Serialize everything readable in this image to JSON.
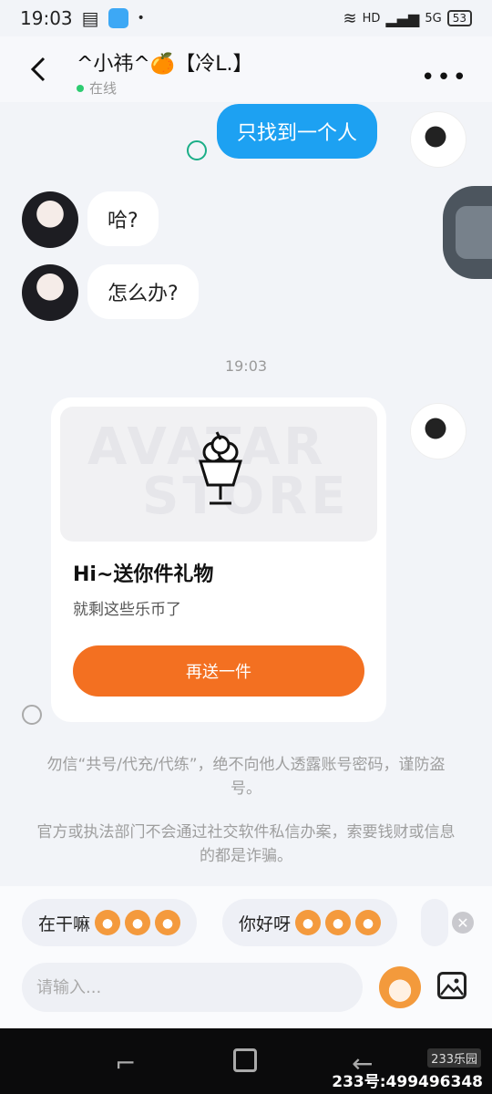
{
  "status_bar": {
    "time": "19:03",
    "battery": "53",
    "network": "5G"
  },
  "header": {
    "back_icon": "back-arrow-icon",
    "title": "^小祎^🍊【冷L.】",
    "status": "在线",
    "more_icon": "more-dots-icon"
  },
  "messages": [
    {
      "from": "me",
      "text": "只找到一个人"
    },
    {
      "from": "other",
      "text": "哈?"
    },
    {
      "from": "other",
      "text": "怎么办?"
    }
  ],
  "timestamp": "19:03",
  "gift": {
    "watermark_line1": "AVATAR",
    "watermark_line2": "STORE",
    "title": "Hi~送你件礼物",
    "subtitle": "就剩这些乐币了",
    "button": "再送一件"
  },
  "notices": [
    "勿信“共号/代充/代练”，绝不向他人透露账号密码，谨防盗号。",
    "官方或执法部门不会通过社交软件私信办案，索要钱财或信息的都是诈骗。"
  ],
  "quick_replies": [
    {
      "label": "在干嘛"
    },
    {
      "label": "你好呀"
    }
  ],
  "input": {
    "placeholder": "请输入..."
  },
  "watermark": {
    "logo": "233乐园",
    "id": "233号:499496348"
  },
  "colors": {
    "accent_blue": "#1da1f2",
    "gift_orange": "#f37021",
    "online_green": "#2ecc71"
  }
}
